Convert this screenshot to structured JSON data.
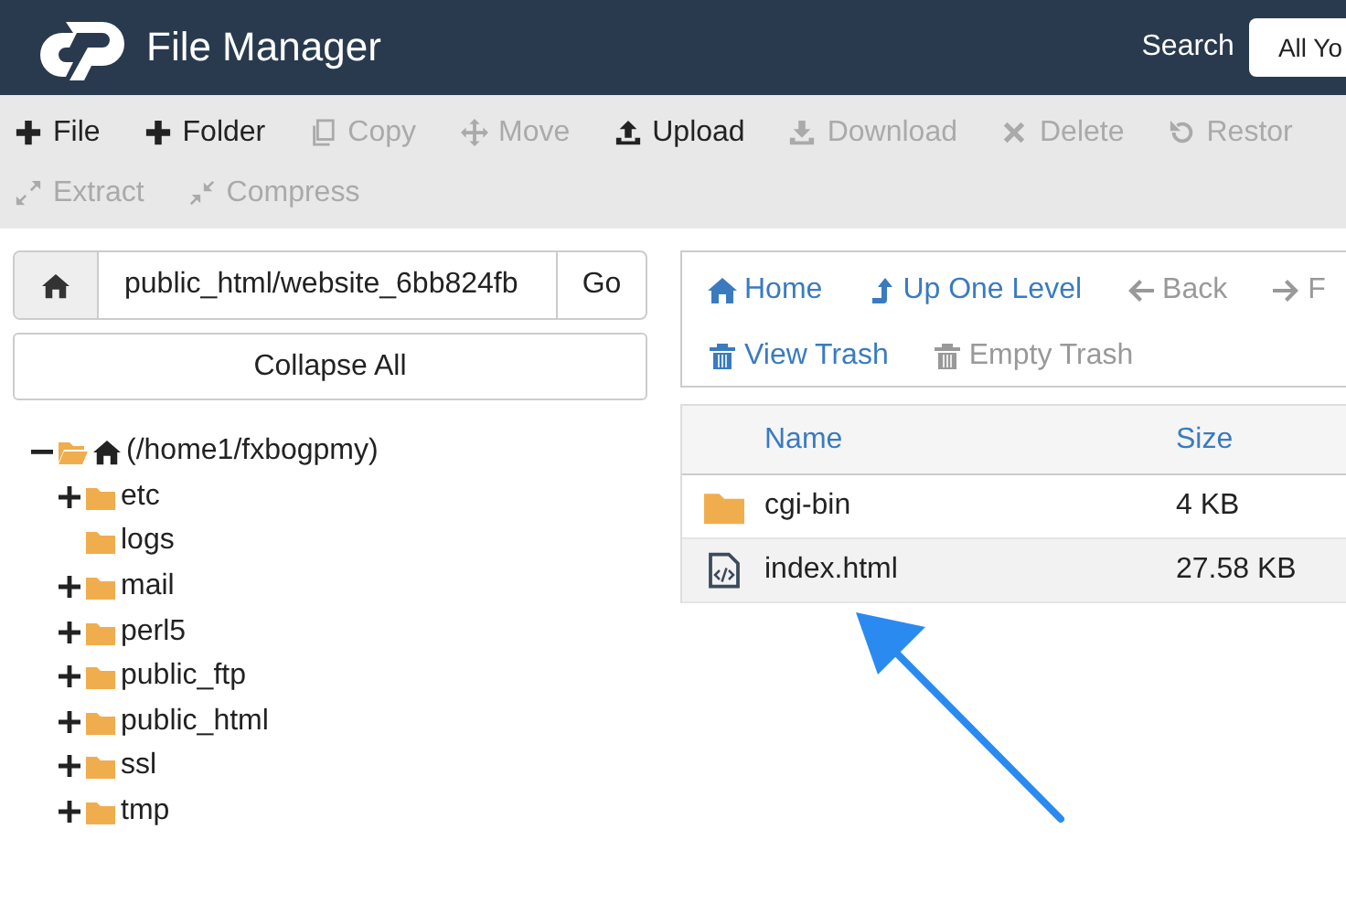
{
  "header": {
    "title": "File Manager",
    "search_label": "Search",
    "search_scope": "All Yo"
  },
  "toolbar": [
    {
      "kind": "plus",
      "label": "File",
      "disabled": false
    },
    {
      "kind": "plus",
      "label": "Folder",
      "disabled": false
    },
    {
      "kind": "copy",
      "label": "Copy",
      "disabled": true
    },
    {
      "kind": "move",
      "label": "Move",
      "disabled": true
    },
    {
      "kind": "upload",
      "label": "Upload",
      "disabled": false
    },
    {
      "kind": "download",
      "label": "Download",
      "disabled": true
    },
    {
      "kind": "delete",
      "label": "Delete",
      "disabled": true
    },
    {
      "kind": "restore",
      "label": "Restor",
      "disabled": true
    },
    {
      "kind": "extract",
      "label": "Extract",
      "disabled": true
    },
    {
      "kind": "compress",
      "label": "Compress",
      "disabled": true
    }
  ],
  "path_bar": {
    "value": "public_html/website_6bb824fb",
    "go": "Go"
  },
  "collapse_button": "Collapse All",
  "tree": {
    "label": "(/home1/fxbogpmy)",
    "expanded": true,
    "children": [
      {
        "label": "etc",
        "has_children": true,
        "expanded": false
      },
      {
        "label": "logs",
        "has_children": false
      },
      {
        "label": "mail",
        "has_children": true,
        "expanded": false
      },
      {
        "label": "perl5",
        "has_children": true,
        "expanded": false
      },
      {
        "label": "public_ftp",
        "has_children": true,
        "expanded": false
      },
      {
        "label": "public_html",
        "has_children": true,
        "expanded": false
      },
      {
        "label": "ssl",
        "has_children": true,
        "expanded": false
      },
      {
        "label": "tmp",
        "has_children": true,
        "expanded": false
      }
    ]
  },
  "nav": [
    {
      "kind": "home",
      "label": "Home",
      "disabled": false
    },
    {
      "kind": "up",
      "label": "Up One Level",
      "disabled": false
    },
    {
      "kind": "back",
      "label": "Back",
      "disabled": true
    },
    {
      "kind": "forward",
      "label": "F",
      "disabled": true
    },
    {
      "kind": "trash",
      "label": "View Trash",
      "disabled": false
    },
    {
      "kind": "trash",
      "label": "Empty Trash",
      "disabled": true
    }
  ],
  "table": {
    "columns": [
      "Name",
      "Size"
    ],
    "rows": [
      {
        "kind": "folder",
        "name": "cgi-bin",
        "size": "4 KB",
        "selected": false
      },
      {
        "kind": "html",
        "name": "index.html",
        "size": "27.58 KB",
        "selected": true
      }
    ]
  }
}
